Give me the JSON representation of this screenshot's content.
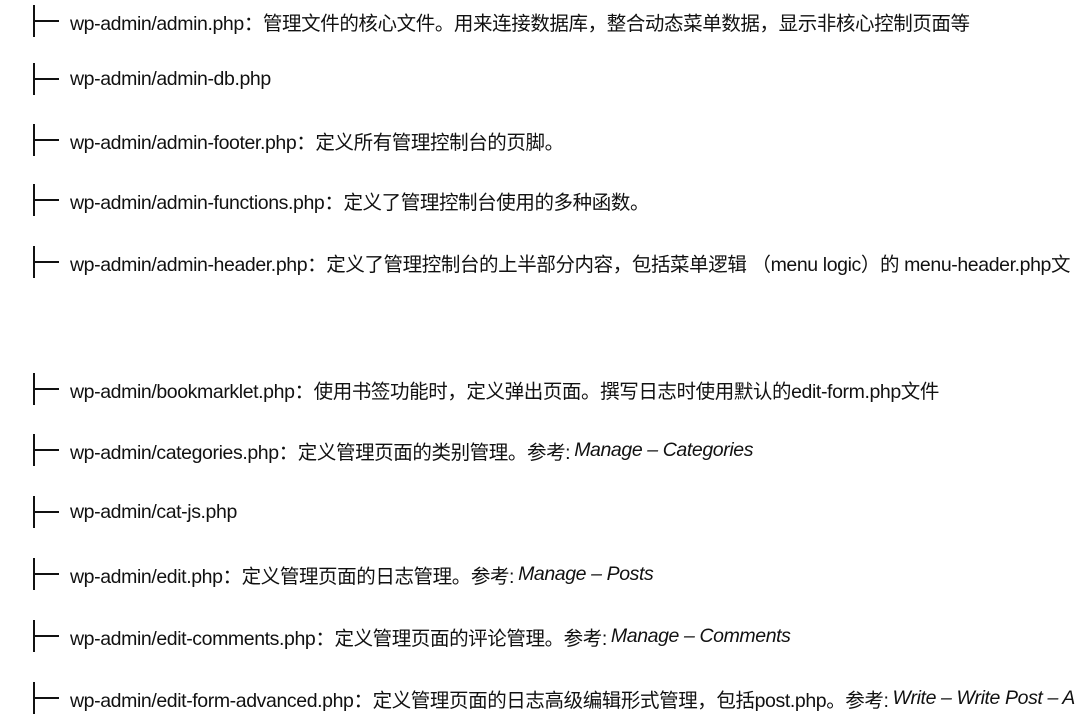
{
  "entries": [
    {
      "text": "wp-admin/admin.php：管理文件的核心文件。用来连接数据库，整合动态菜单数据，显示非核心控制页面等",
      "ref": ""
    },
    {
      "text": "wp-admin/admin-db.php",
      "ref": ""
    },
    {
      "text": "wp-admin/admin-footer.php：定义所有管理控制台的页脚。",
      "ref": ""
    },
    {
      "text": "wp-admin/admin-functions.php：定义了管理控制台使用的多种函数。",
      "ref": ""
    },
    {
      "text": "wp-admin/admin-header.php：定义了管理控制台的上半部分内容，包括菜单逻辑 （menu logic）的 menu-header.php文",
      "ref": ""
    },
    {
      "text": "wp-admin/bookmarklet.php：使用书签功能时，定义弹出页面。撰写日志时使用默认的edit-form.php文件",
      "ref": ""
    },
    {
      "text": "wp-admin/categories.php：定义管理页面的类别管理。参考:",
      "ref": "Manage – Categories"
    },
    {
      "text": "wp-admin/cat-js.php",
      "ref": ""
    },
    {
      "text": "wp-admin/edit.php：定义管理页面的日志管理。参考:",
      "ref": "Manage – Posts"
    },
    {
      "text": "wp-admin/edit-comments.php：定义管理页面的评论管理。参考:",
      "ref": "Manage – Comments"
    },
    {
      "text": "wp-admin/edit-form-advanced.php：定义管理页面的日志高级编辑形式管理，包括post.php。参考:",
      "ref": "Write – Write Post – A"
    }
  ]
}
